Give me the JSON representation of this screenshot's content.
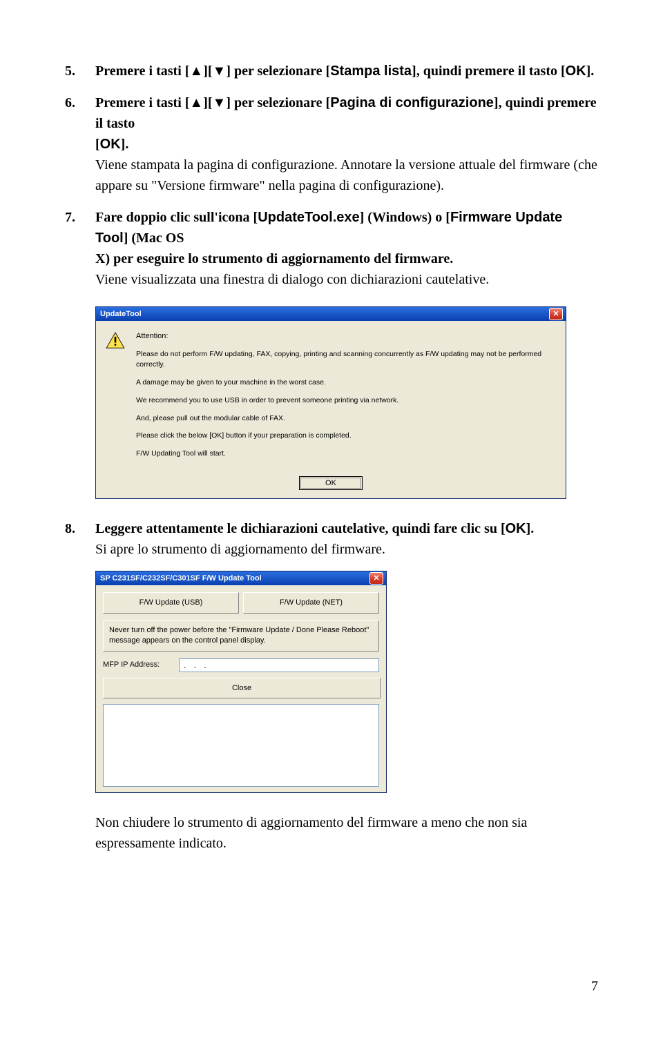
{
  "steps": {
    "s5": {
      "num": "5.",
      "head_pre": "Premere i tasti [▲][▼] per selezionare [",
      "head_hl1": "Stampa lista",
      "head_mid": "], quindi premere il tasto [",
      "head_hl2": "OK",
      "head_post": "]."
    },
    "s6": {
      "num": "6.",
      "head_pre": "Premere i tasti [▲][▼] per selezionare [",
      "head_hl1": "Pagina di configurazione",
      "head_mid": "], quindi premere il tasto",
      "head_line2_pre": "[",
      "head_line2_hl": "OK",
      "head_line2_post": "].",
      "body1": "Viene stampata la pagina di configurazione. Annotare la versione attuale del firmware (che appare su \"Versione firmware\" nella pagina di configurazione)."
    },
    "s7": {
      "num": "7.",
      "head_pre": "Fare doppio clic sull'icona [",
      "head_hl1": "UpdateTool.exe",
      "head_mid1": "] (Windows) o [",
      "head_hl2": "Firmware Update Tool",
      "head_mid2": "] (Mac OS",
      "head_line2": "X) per eseguire lo strumento di aggiornamento del firmware.",
      "body1": "Viene visualizzata una finestra di dialogo con dichiarazioni cautelative."
    },
    "s8": {
      "num": "8.",
      "head_pre": "Leggere attentamente le dichiarazioni cautelative, quindi fare clic su [",
      "head_hl1": "OK",
      "head_post": "].",
      "body1": "Si apre lo strumento di aggiornamento del firmware."
    }
  },
  "dialog1": {
    "title": "UpdateTool",
    "attention": "Attention:",
    "l1": "Please do not perform F/W updating, FAX, copying, printing and scanning concurrently as F/W updating may not be performed correctly.",
    "l2": "A damage may be given to your machine in the worst case.",
    "l3": "We recommend you to use USB in order to prevent someone printing via network.",
    "l4": "And, please pull out the modular cable of FAX.",
    "l5": "Please click the below [OK] button if your preparation is completed.",
    "l6": "F/W Updating Tool will start.",
    "ok": "OK"
  },
  "dialog2": {
    "title": "SP C231SF/C232SF/C301SF F/W Update Tool",
    "btn_usb": "F/W Update (USB)",
    "btn_net": "F/W Update (NET)",
    "msg": "Never turn off the power before the \"Firmware Update / Done Please Reboot\" message appears on the control panel display.",
    "ip_label": "MFP IP Address:",
    "ip_value": ".          .          .",
    "close": "Close"
  },
  "footer": {
    "note": "Non chiudere lo strumento di aggiornamento del firmware a meno che non sia espressamente indicato.",
    "page": "7"
  }
}
